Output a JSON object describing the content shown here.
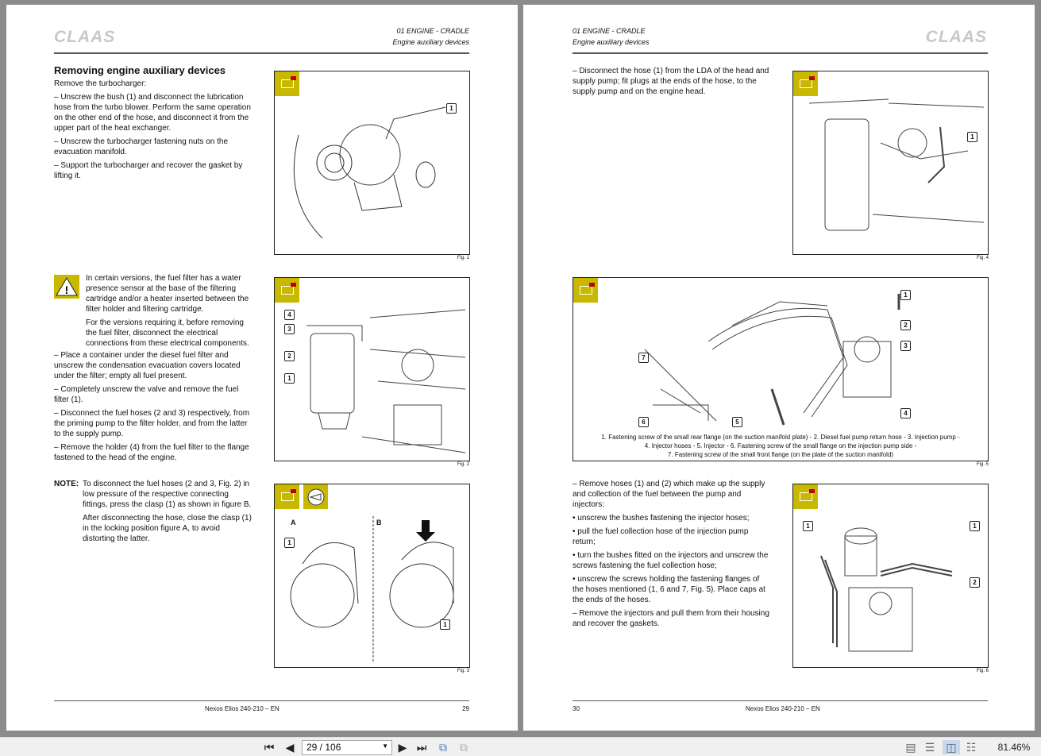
{
  "left_page": {
    "logo": "CLAAS",
    "section": "01 ENGINE - CRADLE",
    "subsection": "Engine auxiliary devices",
    "title": "Removing engine auxiliary devices",
    "block1": [
      "Remove the turbocharger:",
      "– Unscrew the bush (1) and disconnect the lubrication hose from the turbo blower. Perform the same operation on the other end of the hose, and disconnect it from the upper part of the heat exchanger.",
      "– Unscrew the turbocharger fastening nuts on the evacuation manifold.",
      "– Support the turbocharger and recover the gasket by lifting it."
    ],
    "warning": [
      "In certain versions, the fuel filter has a water presence sensor at the base of the filtering cartridge and/or a heater inserted between the filter holder and filtering cartridge.",
      "For the versions requiring it, before removing the fuel filter, disconnect the electrical connections from these electrical components."
    ],
    "block2": [
      "– Place a container under the diesel fuel filter and unscrew the condensation evacuation covers located under the filter; empty all fuel present.",
      "– Completely unscrew the valve and remove the fuel filter (1).",
      "– Disconnect the fuel hoses (2 and 3) respectively, from the priming pump to the filter holder, and from the latter to the supply pump.",
      "– Remove the holder (4) from the fuel filter to the flange fastened to the head of the engine."
    ],
    "note_label": "NOTE:",
    "note": [
      "To disconnect the fuel hoses (2 and 3, Fig. 2) in low pressure of the respective connecting fittings, press the clasp (1) as shown in figure B.",
      "After disconnecting the hose, close the clasp (1) in the locking position figure A, to avoid distorting the latter."
    ],
    "fig1": "Fig. 1",
    "fig2": "Fig. 2",
    "fig3": "Fig. 3",
    "fig3_a": "A",
    "fig3_b": "B",
    "footer_title": "Nexos Elios 240-210 – EN",
    "page_number": "29"
  },
  "right_page": {
    "logo": "CLAAS",
    "section": "01 ENGINE - CRADLE",
    "subsection": "Engine auxiliary devices",
    "block1": "– Disconnect the hose (1) from the LDA of the head and supply pump; fit plugs at the ends of the hose, to the supply pump and on the engine head.",
    "fig5_caption": [
      "1. Fastening screw of the small rear flange (on the suction manifold plate) - 2. Diesel fuel pump return hose - 3. Injection pump -",
      "4. Injector hoses - 5. Injector - 6. Fastening screw of the small flange on the injection pump side -",
      "7. Fastening screw of the small front flange (on the plate of the suction manifold)"
    ],
    "block2": [
      "– Remove hoses (1) and (2) which make up the supply and collection of the fuel between the pump and injectors:",
      "• unscrew the bushes fastening the injector hoses;",
      "• pull the fuel collection hose of the injection pump return;",
      "• turn the bushes fitted on the injectors and unscrew the screws fastening the fuel collection hose;",
      "• unscrew the screws holding the fastening flanges of the hoses mentioned (1, 6 and 7, Fig. 5). Place caps at the ends of the hoses.",
      "– Remove the injectors and pull them from their housing and recover the gaskets."
    ],
    "fig4": "Fig. 4",
    "fig5": "Fig. 5",
    "fig6": "Fig. 6",
    "footer_title": "Nexos Elios 240-210 – EN",
    "page_number": "30"
  },
  "toolbar": {
    "page_field": "29 / 106",
    "zoom": "81.46%"
  }
}
